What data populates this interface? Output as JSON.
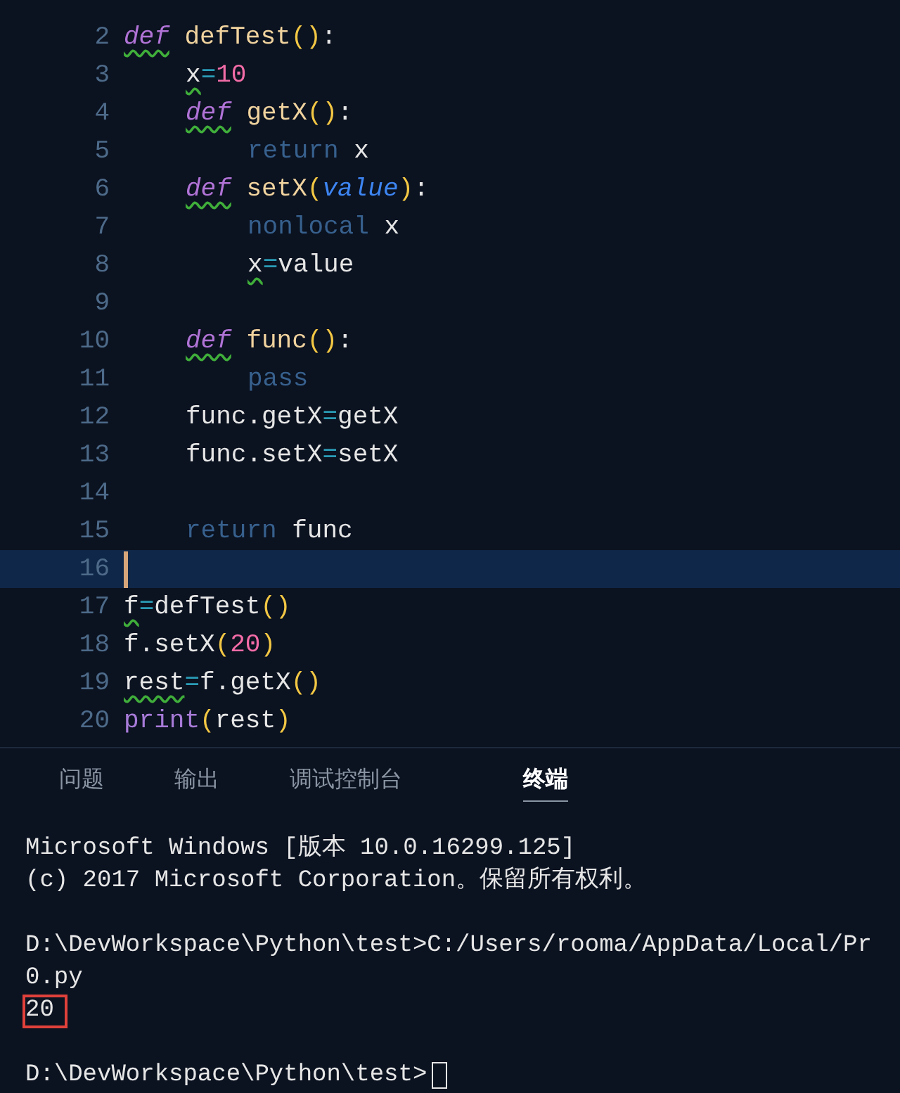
{
  "editor": {
    "lines": [
      {
        "number": "2",
        "current": false,
        "tokens": [
          {
            "text": "def",
            "kind": "keyword",
            "warning": true
          },
          {
            "text": " defTest",
            "kind": "function",
            "warning": false
          },
          {
            "text": "()",
            "kind": "paren",
            "warning": false
          },
          {
            "text": ":",
            "kind": "plain",
            "warning": false
          }
        ],
        "children": [
          {
            "number": "3",
            "current": false,
            "tokens": [
              {
                "text": "x",
                "kind": "plain",
                "warning": true
              },
              {
                "text": "=",
                "kind": "operator",
                "warning": false
              },
              {
                "text": "10",
                "kind": "number",
                "warning": false
              }
            ]
          },
          {
            "number": "4",
            "current": false,
            "tokens": [
              {
                "text": "def",
                "kind": "keyword",
                "warning": true
              },
              {
                "text": " getX",
                "kind": "function",
                "warning": false
              },
              {
                "text": "()",
                "kind": "paren",
                "warning": false
              },
              {
                "text": ":",
                "kind": "plain",
                "warning": false
              }
            ],
            "children": [
              {
                "number": "5",
                "current": false,
                "tokens": [
                  {
                    "text": "return",
                    "kind": "control",
                    "warning": false
                  },
                  {
                    "text": " x",
                    "kind": "plain",
                    "warning": false
                  }
                ]
              }
            ]
          },
          {
            "number": "6",
            "current": false,
            "tokens": [
              {
                "text": "def",
                "kind": "keyword",
                "warning": true
              },
              {
                "text": " setX",
                "kind": "function",
                "warning": false
              },
              {
                "text": "(",
                "kind": "paren",
                "warning": false
              },
              {
                "text": "value",
                "kind": "parameter",
                "warning": false
              },
              {
                "text": ")",
                "kind": "paren",
                "warning": false
              },
              {
                "text": ":",
                "kind": "plain",
                "warning": false
              }
            ],
            "children": [
              {
                "number": "7",
                "current": false,
                "tokens": [
                  {
                    "text": "nonlocal",
                    "kind": "control",
                    "warning": false
                  },
                  {
                    "text": " x",
                    "kind": "plain",
                    "warning": false
                  }
                ]
              },
              {
                "number": "8",
                "current": false,
                "tokens": [
                  {
                    "text": "x",
                    "kind": "plain",
                    "warning": true
                  },
                  {
                    "text": "=",
                    "kind": "operator",
                    "warning": false
                  },
                  {
                    "text": "value",
                    "kind": "plain",
                    "warning": false
                  }
                ]
              }
            ]
          },
          {
            "number": "9",
            "current": false
          },
          {
            "number": "10",
            "current": false,
            "tokens": [
              {
                "text": "def",
                "kind": "keyword",
                "warning": true
              },
              {
                "text": " func",
                "kind": "function",
                "warning": false
              },
              {
                "text": "()",
                "kind": "paren",
                "warning": false
              },
              {
                "text": ":",
                "kind": "plain",
                "warning": false
              }
            ],
            "children": [
              {
                "number": "11",
                "current": false,
                "tokens": [
                  {
                    "text": "pass",
                    "kind": "control",
                    "warning": false
                  }
                ]
              }
            ]
          },
          {
            "number": "12",
            "current": false,
            "tokens": [
              {
                "text": "func.getX",
                "kind": "plain",
                "warning": false
              },
              {
                "text": "=",
                "kind": "operator",
                "warning": false
              },
              {
                "text": "getX",
                "kind": "plain",
                "warning": false
              }
            ]
          },
          {
            "number": "13",
            "current": false,
            "tokens": [
              {
                "text": "func.setX",
                "kind": "plain",
                "warning": false
              },
              {
                "text": "=",
                "kind": "operator",
                "warning": false
              },
              {
                "text": "setX",
                "kind": "plain",
                "warning": false
              }
            ]
          },
          {
            "number": "14",
            "current": false
          },
          {
            "number": "15",
            "current": false,
            "tokens": [
              {
                "text": "return",
                "kind": "control",
                "warning": false
              },
              {
                "text": " func",
                "kind": "plain",
                "warning": false
              }
            ]
          }
        ]
      },
      {
        "number": "16",
        "current": true
      },
      {
        "number": "17",
        "current": false,
        "tokens": [
          {
            "text": "f",
            "kind": "plain",
            "warning": true
          },
          {
            "text": "=",
            "kind": "operator",
            "warning": false
          },
          {
            "text": "defTest",
            "kind": "plain",
            "warning": false
          },
          {
            "text": "()",
            "kind": "paren",
            "warning": false
          }
        ]
      },
      {
        "number": "18",
        "current": false,
        "tokens": [
          {
            "text": "f.setX",
            "kind": "plain",
            "warning": false
          },
          {
            "text": "(",
            "kind": "paren",
            "warning": false
          },
          {
            "text": "20",
            "kind": "number",
            "warning": false
          },
          {
            "text": ")",
            "kind": "paren",
            "warning": false
          }
        ]
      },
      {
        "number": "19",
        "current": false,
        "tokens": [
          {
            "text": "rest",
            "kind": "plain",
            "warning": true
          },
          {
            "text": "=",
            "kind": "operator",
            "warning": false
          },
          {
            "text": "f.getX",
            "kind": "plain",
            "warning": false
          },
          {
            "text": "()",
            "kind": "paren",
            "warning": false
          }
        ]
      },
      {
        "number": "20",
        "current": false,
        "tokens": [
          {
            "text": "print",
            "kind": "builtin",
            "warning": false
          },
          {
            "text": "(",
            "kind": "paren",
            "warning": false
          },
          {
            "text": "rest",
            "kind": "plain",
            "warning": false
          },
          {
            "text": ")",
            "kind": "paren",
            "warning": false
          }
        ]
      }
    ]
  },
  "panel": {
    "tabs": [
      {
        "label": "问题",
        "selected": false
      },
      {
        "label": "输出",
        "selected": false
      },
      {
        "label": "调试控制台",
        "selected": false
      },
      {
        "label": "终端",
        "selected": true
      }
    ],
    "terminal": [
      {
        "kind": "text",
        "text": "Microsoft Windows [版本 10.0.16299.125]",
        "highlighted": false,
        "cursor": false
      },
      {
        "kind": "text",
        "text": "(c) 2017 Microsoft Corporation。保留所有权利。",
        "highlighted": false,
        "cursor": false
      },
      {
        "kind": "blank"
      },
      {
        "kind": "text",
        "text": "D:\\DevWorkspace\\Python\\test>C:/Users/rooma/AppData/Local/Pr",
        "highlighted": false,
        "cursor": false
      },
      {
        "kind": "text",
        "text": "0.py",
        "highlighted": false,
        "cursor": false
      },
      {
        "kind": "text",
        "text": "20",
        "highlighted": true,
        "cursor": false
      },
      {
        "kind": "blank"
      },
      {
        "kind": "text",
        "text": "D:\\DevWorkspace\\Python\\test>",
        "highlighted": false,
        "cursor": true
      }
    ]
  }
}
